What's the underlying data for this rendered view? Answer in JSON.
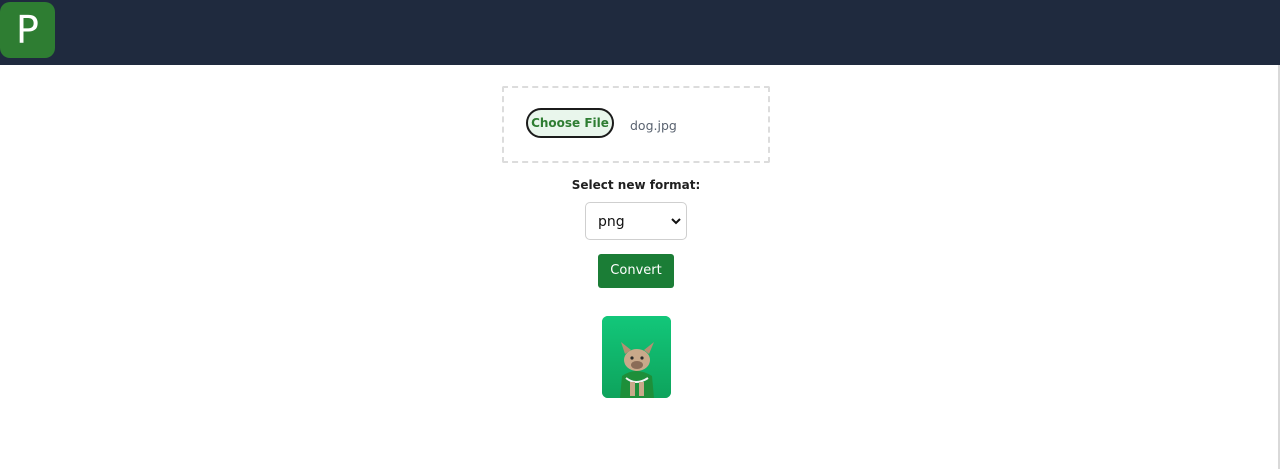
{
  "header": {
    "logo_letter": "P",
    "colors": {
      "bar": "#1f2a3e",
      "logo": "#2e7d32"
    }
  },
  "upload": {
    "button_label": "Choose File",
    "file_name": "dog.jpg"
  },
  "format": {
    "label": "Select new format:",
    "selected": "png"
  },
  "actions": {
    "convert_label": "Convert",
    "accent": "#1b7d36"
  },
  "preview": {
    "icon": "dog-image-thumbnail",
    "background": "#16b86a"
  }
}
